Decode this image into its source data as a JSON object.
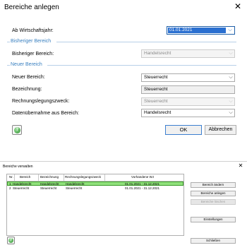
{
  "dialog1": {
    "title": "Bereiche anlegen",
    "close_label": "✕",
    "ab_wj_label": "Ab Wirtschaftsjahr:",
    "ab_wj_value": "01.01.2021",
    "group_bisheriger": "Bisheriger Bereich",
    "bisheriger_label": "Bisheriger Bereich:",
    "bisheriger_value": "Handelsrecht",
    "group_neuer": "Neuer Bereich",
    "neuer_label": "Neuer Bereich:",
    "neuer_value": "Steuerrecht",
    "bezeichnung_label": "Bezeichnung:",
    "bezeichnung_value": "Steuerrecht",
    "rl_zweck_label": "Rechnungslegungszweck:",
    "rl_zweck_value": "Steuerrecht",
    "datenuebernahme_label": "Datenübernahme aus Bereich:",
    "datenuebernahme_value": "Handelsrecht",
    "ok_label": "OK",
    "cancel_label": "Abbrechen",
    "dropdown_arrow": "⌵"
  },
  "dialog2": {
    "title": "Bereiche verwalten",
    "close_label": "✕",
    "columns": [
      "Nr.",
      "Bereich",
      "Bezeichnung",
      "Rechnungslegungszweck",
      "Vorhandene WJ"
    ],
    "rows": [
      {
        "nr": "1",
        "bereich": "Handelsrecht",
        "bezeichnung": "Handelsrecht",
        "zweck": "Handelsrecht",
        "wj": "01.01.2021 - 31.12.2021"
      },
      {
        "nr": "2",
        "bereich": "Steuerrecht",
        "bezeichnung": "Steuerrecht",
        "zweck": "Steuerrecht",
        "wj": "01.01.2021 - 31.12.2021"
      }
    ],
    "btn_aendern": "Bereich ändern",
    "btn_anlegen": "Bereiche anlegen",
    "btn_loeschen": "Bereiche löschen",
    "btn_einstellungen": "Einstellungen",
    "btn_schliessen": "Schließen"
  },
  "colors": {
    "accent": "#2a6fd0",
    "group_title": "#3a80c0",
    "selected_row": "#8fe07a"
  }
}
